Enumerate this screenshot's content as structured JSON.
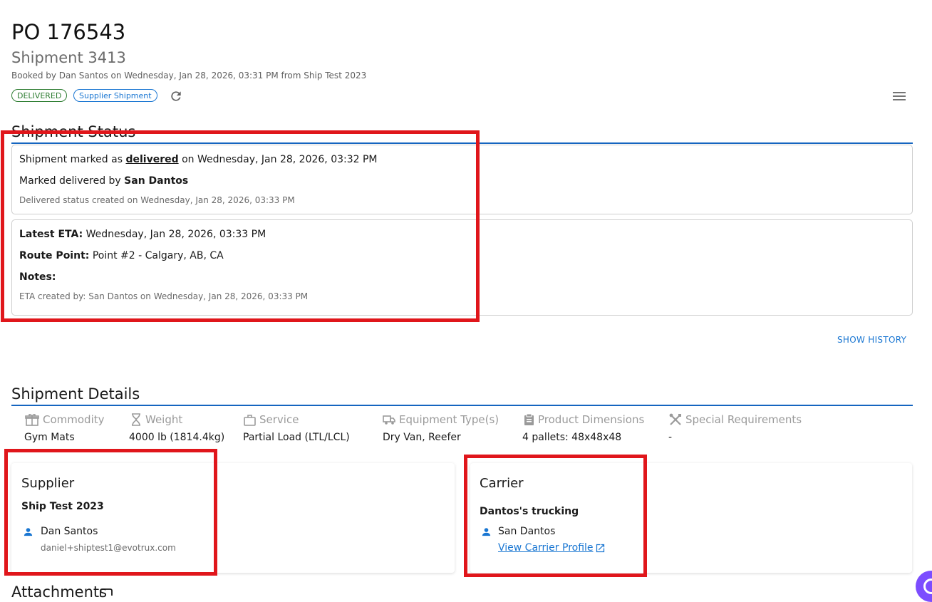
{
  "header": {
    "po_title": "PO 176543",
    "shipment_title": "Shipment 3413",
    "booked_line": "Booked by Dan Santos on Wednesday, Jan 28, 2026, 03:31 PM from Ship Test 2023",
    "chips": {
      "delivered": "DELIVERED",
      "supplier": "Supplier Shipment"
    }
  },
  "status": {
    "section_title": "Shipment Status",
    "delivered_card": {
      "prefix": "Shipment marked as ",
      "status_word": "delivered",
      "suffix": " on Wednesday, Jan 28, 2026, 03:32 PM",
      "marked_by_label": "Marked delivered by ",
      "marked_by_name": "San Dantos",
      "created_line": "Delivered status created on Wednesday, Jan 28, 2026, 03:33 PM"
    },
    "eta_card": {
      "eta_label": "Latest ETA:",
      "eta_value": " Wednesday, Jan 28, 2026, 03:33 PM",
      "route_label": "Route Point:",
      "route_value": " Point #2 - Calgary, AB, CA",
      "notes_label": "Notes:",
      "created_line": "ETA created by: San Dantos on Wednesday, Jan 28, 2026, 03:33 PM"
    },
    "show_history": "SHOW HISTORY"
  },
  "details": {
    "section_title": "Shipment Details",
    "fields": [
      {
        "label": "Commodity",
        "value": "Gym Mats",
        "icon": "gift-icon"
      },
      {
        "label": "Weight",
        "value": "4000 lb (1814.4kg)",
        "icon": "hourglass-icon"
      },
      {
        "label": "Service",
        "value": "Partial Load (LTL/LCL)",
        "icon": "briefcase-icon"
      },
      {
        "label": "Equipment Type(s)",
        "value": "Dry Van, Reefer",
        "icon": "truck-icon"
      },
      {
        "label": "Product Dimensions",
        "value": "4 pallets: 48x48x48",
        "icon": "clipboard-icon"
      },
      {
        "label": "Special Requirements",
        "value": "-",
        "icon": "tools-icon"
      }
    ]
  },
  "supplier": {
    "title": "Supplier",
    "company": "Ship Test 2023",
    "contact_name": "Dan Santos",
    "contact_email": "daniel+shiptest1@evotrux.com"
  },
  "carrier": {
    "title": "Carrier",
    "company": "Dantos's trucking",
    "contact_name": "San Dantos",
    "profile_link": "View Carrier Profile"
  },
  "attachments": {
    "title": "Attachments"
  },
  "colors": {
    "accent": "#1976d2",
    "success": "#2e7d32",
    "highlight": "#e0161b",
    "rule": "#1565c0"
  }
}
